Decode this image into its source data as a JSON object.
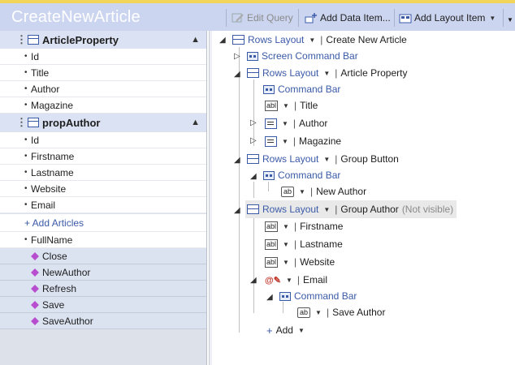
{
  "window": {
    "title": "CreateNewArticle"
  },
  "toolbar": {
    "edit_query": "Edit Query",
    "add_data_item": "Add Data Item...",
    "add_layout_item": "Add Layout Item"
  },
  "left_panel": {
    "article_property": {
      "name": "ArticleProperty",
      "fields": [
        "Id",
        "Title",
        "Author",
        "Magazine"
      ]
    },
    "prop_author": {
      "name": "propAuthor",
      "fields": [
        "Id",
        "Firstname",
        "Lastname",
        "Website",
        "Email"
      ],
      "add_link": "+ Add Articles",
      "extra_field": "FullName"
    },
    "commands": [
      "Close",
      "NewAuthor",
      "Refresh",
      "Save",
      "SaveAuthor"
    ]
  },
  "tree": {
    "root_type": "Rows Layout",
    "root_name": "Create New Article",
    "screen_command_bar": "Screen Command Bar",
    "article_layout_type": "Rows Layout",
    "article_layout_name": "Article Property",
    "command_bar_1": "Command Bar",
    "title": "Title",
    "author": "Author",
    "magazine": "Magazine",
    "group_button_type": "Rows Layout",
    "group_button_name": "Group Button",
    "command_bar_2": "Command Bar",
    "new_author": "New Author",
    "group_author_type": "Rows Layout",
    "group_author_name": "Group Author",
    "not_visible": "(Not visible)",
    "firstname": "Firstname",
    "lastname": "Lastname",
    "website": "Website",
    "email": "Email",
    "command_bar_3": "Command Bar",
    "save_author": "Save Author",
    "add": "Add"
  }
}
